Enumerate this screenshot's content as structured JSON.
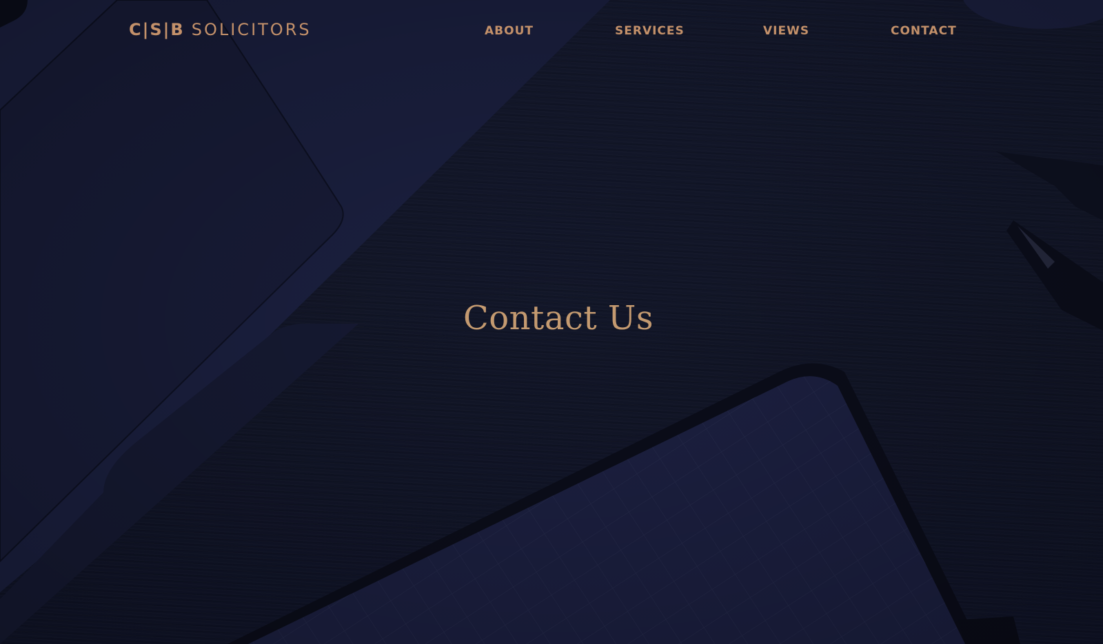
{
  "brand": {
    "mark": "C|S|B",
    "name": "SOLICITORS"
  },
  "nav": {
    "items": [
      {
        "label": "ABOUT"
      },
      {
        "label": "SERVICES"
      },
      {
        "label": "VIEWS"
      },
      {
        "label": "CONTACT"
      }
    ]
  },
  "hero": {
    "title": "Contact Us"
  },
  "colors": {
    "accent": "#c4916a",
    "background": "#151a30"
  }
}
